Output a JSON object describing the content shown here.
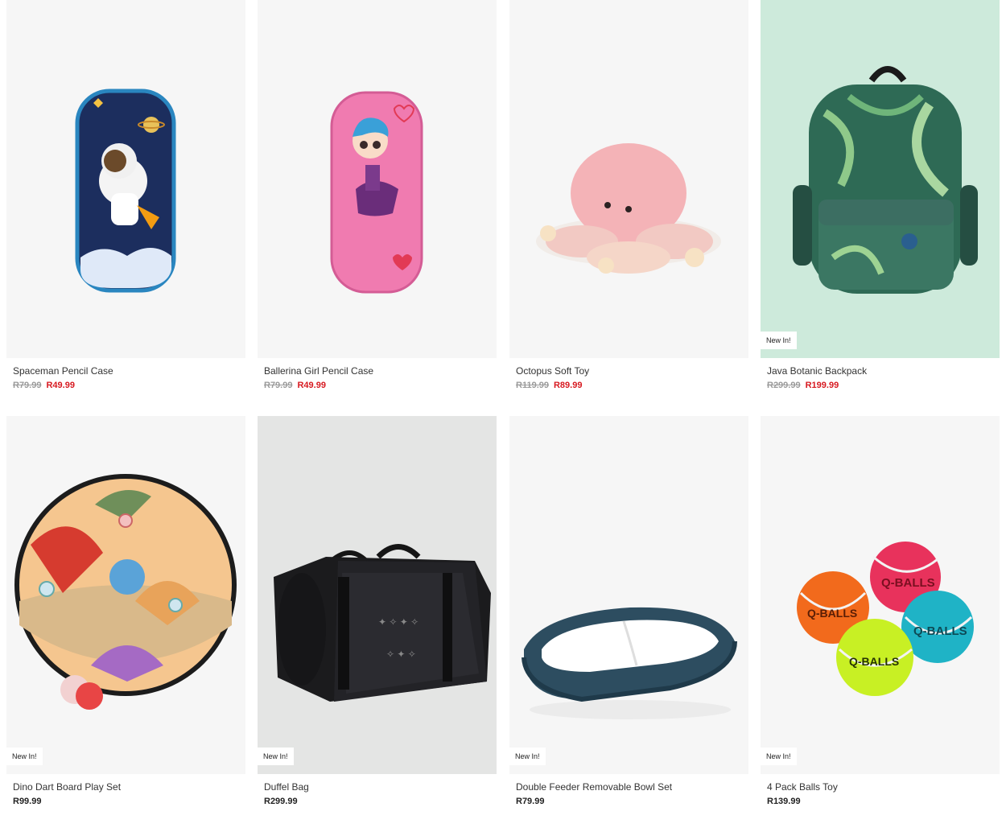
{
  "products": [
    {
      "name": "Spaceman Pencil Case",
      "was_price": "R79.99",
      "price": "R49.99",
      "sale": true,
      "badge": "",
      "image_icon": "spaceman-pencil-case-image"
    },
    {
      "name": "Ballerina Girl Pencil Case",
      "was_price": "R79.99",
      "price": "R49.99",
      "sale": true,
      "badge": "",
      "image_icon": "ballerina-pencil-case-image"
    },
    {
      "name": "Octopus Soft Toy",
      "was_price": "R119.99",
      "price": "R89.99",
      "sale": true,
      "badge": "",
      "image_icon": "octopus-toy-image"
    },
    {
      "name": "Java Botanic Backpack",
      "was_price": "R299.99",
      "price": "R199.99",
      "sale": true,
      "badge": "New In!",
      "image_icon": "backpack-image"
    },
    {
      "name": "Dino Dart Board Play Set",
      "was_price": "",
      "price": "R99.99",
      "sale": false,
      "badge": "New In!",
      "image_icon": "dart-board-image"
    },
    {
      "name": "Duffel Bag",
      "was_price": "",
      "price": "R299.99",
      "sale": false,
      "badge": "New In!",
      "image_icon": "duffel-bag-image"
    },
    {
      "name": "Double Feeder Removable Bowl Set",
      "was_price": "",
      "price": "R79.99",
      "sale": false,
      "badge": "New In!",
      "image_icon": "bowl-set-image"
    },
    {
      "name": "4 Pack Balls Toy",
      "was_price": "",
      "price": "R139.99",
      "sale": false,
      "badge": "New In!",
      "image_icon": "balls-toy-image"
    }
  ],
  "colors": {
    "sale_price": "#d71920",
    "was_price": "#9a9a9a",
    "regular_price": "#222222",
    "image_bg": "#f6f6f6"
  }
}
